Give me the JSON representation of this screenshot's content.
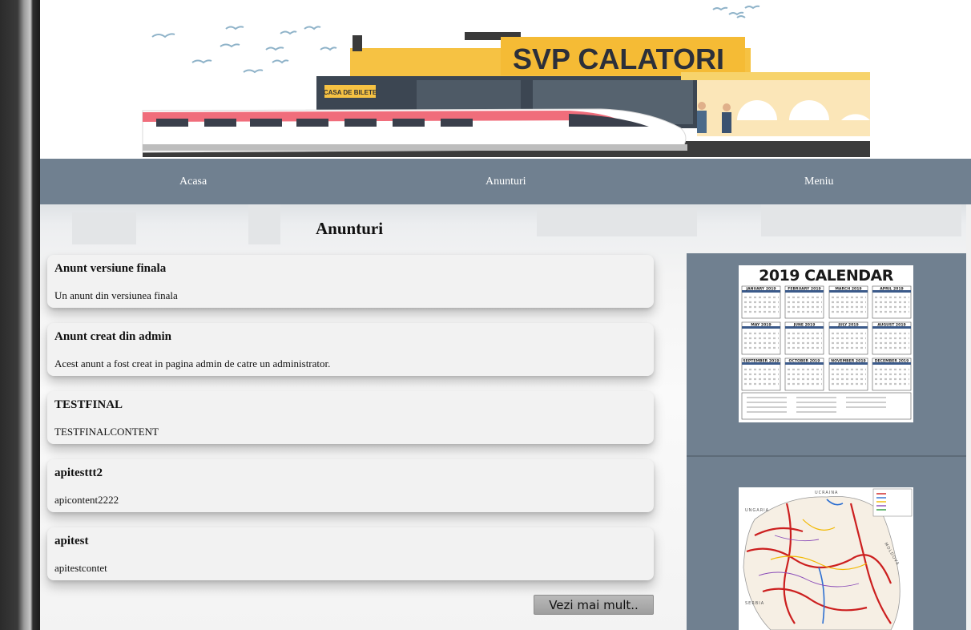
{
  "banner": {
    "station_sign": "SVP CALATORI",
    "ticket_sign": "CASA DE BILETE"
  },
  "nav": {
    "items": [
      {
        "label": "Acasa"
      },
      {
        "label": "Anunturi"
      },
      {
        "label": "Meniu"
      }
    ]
  },
  "main": {
    "title": "Anunturi",
    "announcements": [
      {
        "title": "Anunt versiune finala",
        "content": "Un anunt din versiunea finala"
      },
      {
        "title": "Anunt creat din admin",
        "content": "Acest anunt a fost creat in pagina admin de catre un administrator."
      },
      {
        "title": "TESTFINAL",
        "content": "TESTFINALCONTENT"
      },
      {
        "title": "apitesttt2",
        "content": "apicontent2222"
      },
      {
        "title": "apitest",
        "content": "apitestcontet"
      }
    ],
    "more_button": "Vezi mai mult.."
  },
  "sidebar": {
    "calendar_title": "2019 CALENDAR",
    "calendar_months": [
      "JANUARY 2019",
      "FEBRUARY 2019",
      "MARCH 2019",
      "APRIL 2019",
      "MAY 2019",
      "JUNE 2019",
      "JULY 2019",
      "AUGUST 2019",
      "SEPTEMBER 2019",
      "OCTOBER 2019",
      "NOVEMBER 2019",
      "DECEMBER 2019"
    ],
    "map_labels": [
      "UCRAINA",
      "UNGARIA",
      "MOLDOVA",
      "SERBIA"
    ]
  },
  "colors": {
    "nav_bg": "#708090",
    "sidebar_bg": "#708090",
    "card_bg": "#f2f2f2",
    "banner_accent": "#f6c243"
  }
}
